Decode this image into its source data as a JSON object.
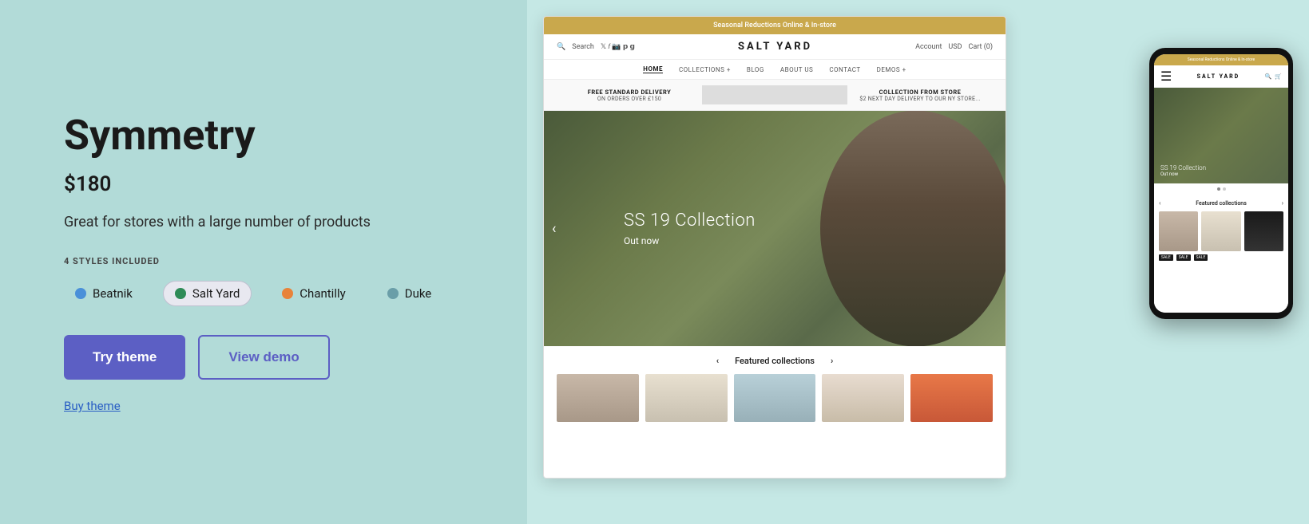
{
  "left": {
    "title": "Symmetry",
    "price": "$180",
    "description": "Great for stores with a large number of products",
    "styles_label": "4 STYLES INCLUDED",
    "styles": [
      {
        "id": "beatnik",
        "label": "Beatnik",
        "dot_color": "blue",
        "active": false
      },
      {
        "id": "salt-yard",
        "label": "Salt Yard",
        "dot_color": "green",
        "active": true
      },
      {
        "id": "chantilly",
        "label": "Chantilly",
        "dot_color": "orange",
        "active": false
      },
      {
        "id": "duke",
        "label": "Duke",
        "dot_color": "teal",
        "active": false
      }
    ],
    "try_theme_label": "Try theme",
    "view_demo_label": "View demo",
    "buy_theme_label": "Buy theme"
  },
  "preview": {
    "desktop": {
      "top_bar_text": "Seasonal Reductions Online & In-store",
      "search_label": "Search",
      "brand_name": "SALT YARD",
      "account_label": "Account",
      "currency_label": "USD",
      "cart_label": "Cart (0)",
      "nav_items": [
        "HOME",
        "COLLECTIONS +",
        "BLOG",
        "ABOUT US",
        "CONTACT",
        "DEMOS +"
      ],
      "delivery_text": "FREE STANDARD DELIVERY",
      "delivery_sub": "ON ORDERS OVER £150",
      "collection_text": "COLLECTION FROM STORE",
      "collection_sub": "$2 NEXT DAY DELIVERY TO OUR NY STORE...",
      "hero_title": "SS 19 Collection",
      "hero_subtitle": "Out now",
      "featured_label": "Featured collections"
    },
    "mobile": {
      "top_bar_text": "Seasonal Reductions Online & In-store",
      "brand_name": "SALT YARD",
      "hero_title": "SS 19 Collection",
      "hero_subtitle": "Out now",
      "featured_label": "Featured collections"
    }
  }
}
